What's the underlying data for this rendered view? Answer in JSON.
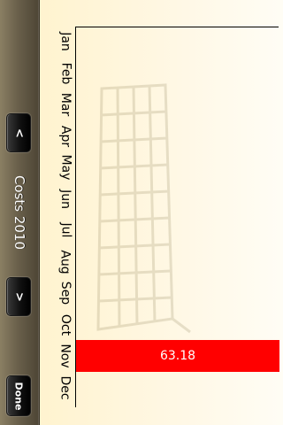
{
  "toolbar": {
    "prev_label": "<",
    "next_label": ">",
    "title": "Costs 2010",
    "done_label": "Done"
  },
  "colors": {
    "bar": "#ff0000",
    "toolbar": "#6a604b",
    "background": "#fff6d9"
  },
  "chart_data": {
    "type": "bar",
    "orientation": "horizontal",
    "categories": [
      "Jan",
      "Feb",
      "Mar",
      "Apr",
      "May",
      "Jun",
      "Jul",
      "Aug",
      "Sep",
      "Oct",
      "Nov",
      "Dec"
    ],
    "values": [
      null,
      null,
      null,
      null,
      null,
      null,
      null,
      null,
      null,
      null,
      63.18,
      null
    ],
    "value_labels": [
      "",
      "",
      "",
      "",
      "",
      "",
      "",
      "",
      "",
      "",
      "63.18",
      ""
    ],
    "xlim": [
      0,
      63.18
    ]
  }
}
